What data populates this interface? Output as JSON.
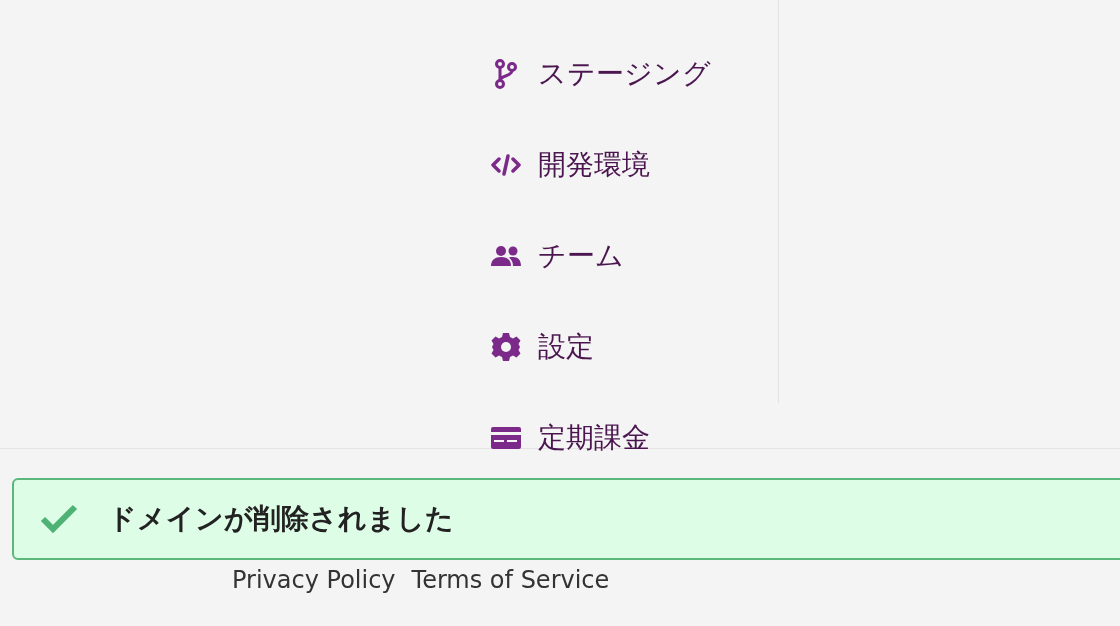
{
  "menu": [
    {
      "kind": "branch",
      "label": "ステージング"
    },
    {
      "kind": "code",
      "label": "開発環境"
    },
    {
      "kind": "team",
      "label": "チーム"
    },
    {
      "kind": "gear",
      "label": "設定"
    },
    {
      "kind": "card",
      "label": "定期課金"
    }
  ],
  "toast": {
    "kind": "success",
    "message": "ドメインが削除されました"
  },
  "footer_links": [
    "Privacy Policy",
    "Terms of Service"
  ]
}
